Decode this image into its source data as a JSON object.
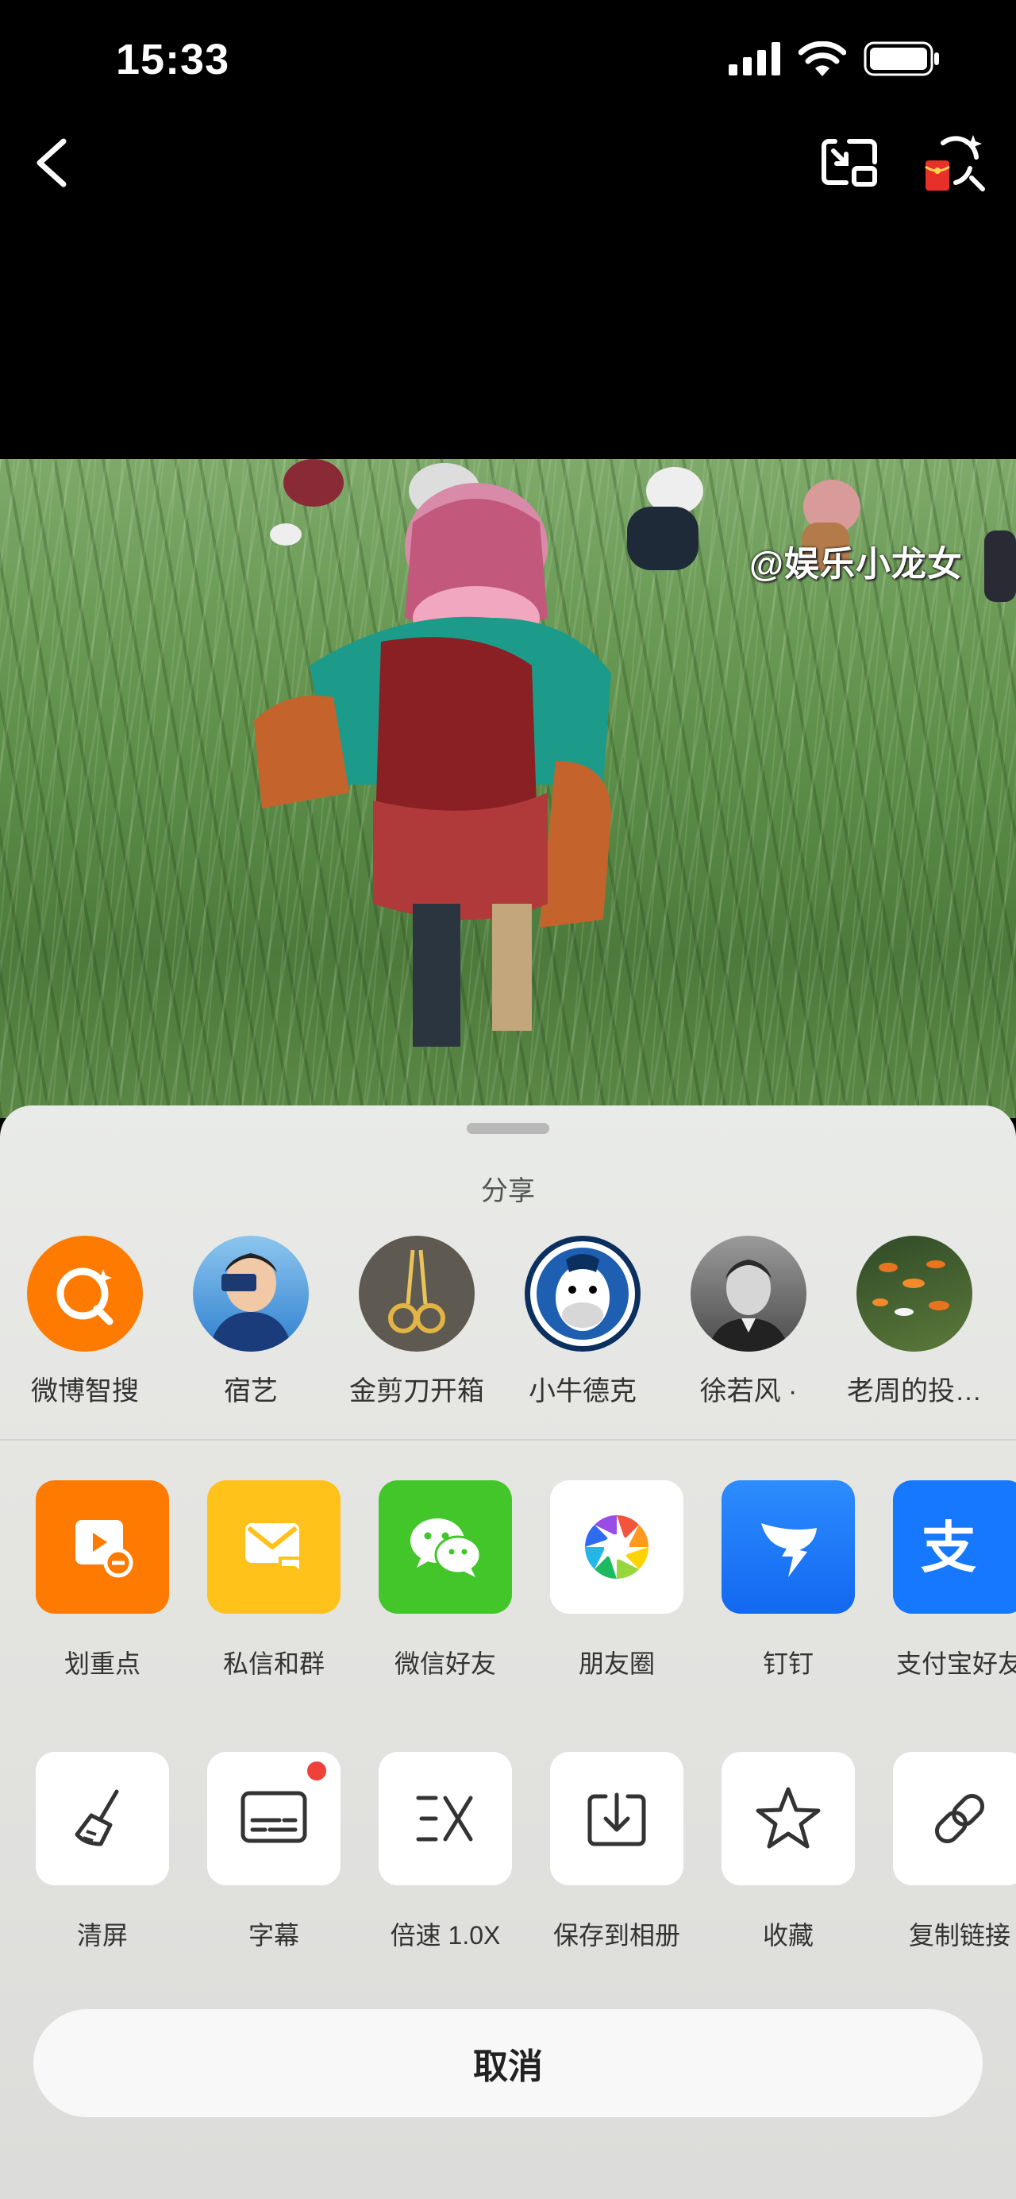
{
  "status_bar": {
    "time": "15:33"
  },
  "video": {
    "watermark": "@娱乐小龙女"
  },
  "share_sheet": {
    "title": "分享",
    "contacts": [
      {
        "name": "微博智搜",
        "icon": "weibo-search-icon"
      },
      {
        "name": "宿艺",
        "icon": "avatar"
      },
      {
        "name": "金剪刀开箱",
        "icon": "avatar"
      },
      {
        "name": "小牛德克",
        "icon": "avatar"
      },
      {
        "name": "徐若风 ·",
        "icon": "avatar"
      },
      {
        "name": "老周的投…",
        "icon": "avatar"
      }
    ],
    "share_apps": [
      {
        "label": "划重点",
        "icon": "highlight-icon",
        "color": "#FF7A00"
      },
      {
        "label": "私信和群",
        "icon": "message-icon",
        "color": "#FFC21A"
      },
      {
        "label": "微信好友",
        "icon": "wechat-icon",
        "color": "#42C62A"
      },
      {
        "label": "朋友圈",
        "icon": "moments-icon",
        "color": "#FFFFFF"
      },
      {
        "label": "钉钉",
        "icon": "dingtalk-icon",
        "color": "#1677FF"
      },
      {
        "label": "支付宝好友",
        "icon": "alipay-icon",
        "color": "#1677FF"
      }
    ],
    "actions": [
      {
        "label": "清屏",
        "icon": "broom-icon"
      },
      {
        "label": "字幕",
        "icon": "subtitle-icon"
      },
      {
        "label": "倍速 1.0X",
        "icon": "speed-icon"
      },
      {
        "label": "保存到相册",
        "icon": "download-icon"
      },
      {
        "label": "收藏",
        "icon": "star-icon"
      },
      {
        "label": "复制链接",
        "icon": "link-icon"
      }
    ],
    "cancel_label": "取消"
  }
}
